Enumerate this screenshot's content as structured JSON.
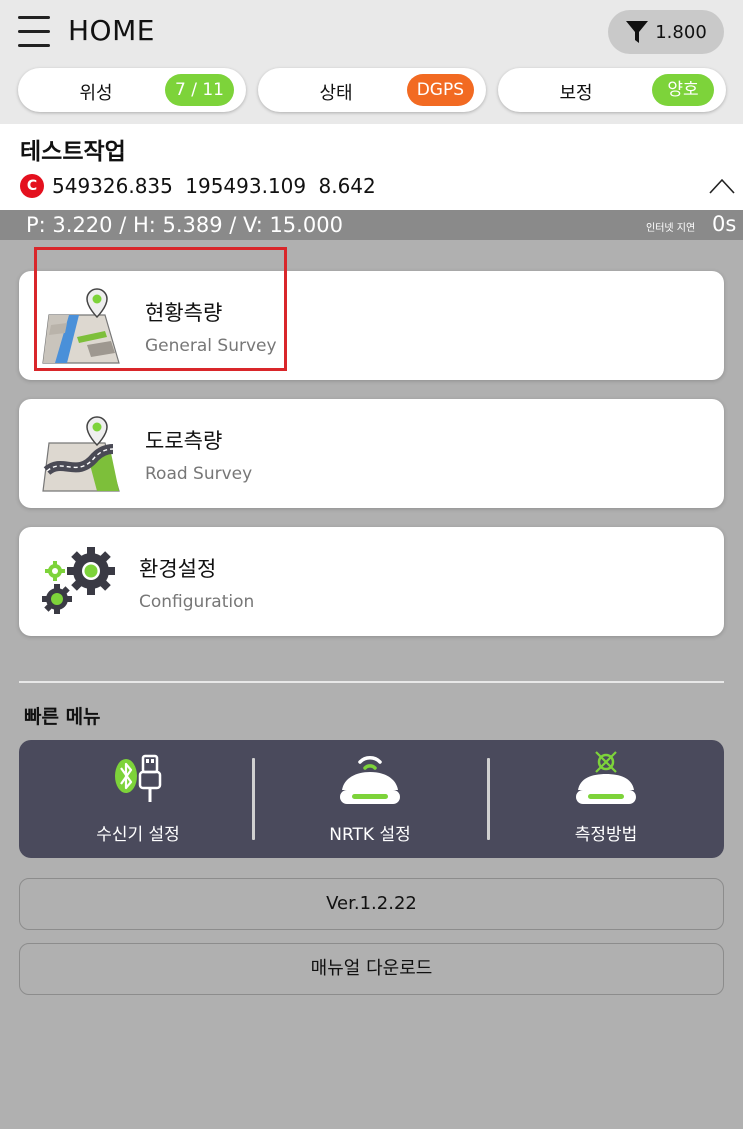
{
  "header": {
    "title": "HOME",
    "filter_value": "1.800"
  },
  "status": [
    {
      "label": "위성",
      "badge": "7 / 11",
      "badge_color": "#7dd33a"
    },
    {
      "label": "상태",
      "badge": "DGPS",
      "badge_color": "#f26a22"
    },
    {
      "label": "보정",
      "badge": "양호",
      "badge_color": "#7dd33a"
    }
  ],
  "project": {
    "name": "테스트작업",
    "coord_badge": "C",
    "x": "549326.835",
    "y": "195493.109",
    "z": "8.642"
  },
  "precision": {
    "text": "P: 3.220 / H: 5.389 / V: 15.000",
    "delay_label": "인터넷 지연",
    "delay_value": "0s"
  },
  "menu": [
    {
      "title": "현황측량",
      "subtitle": "General Survey",
      "icon": "map-pin-icon"
    },
    {
      "title": "도로측량",
      "subtitle": "Road Survey",
      "icon": "road-map-icon"
    },
    {
      "title": "환경설정",
      "subtitle": "Configuration",
      "icon": "gears-icon"
    }
  ],
  "quick_menu": {
    "title": "빠른 메뉴",
    "items": [
      {
        "label": "수신기 설정",
        "icon": "bluetooth-usb-icon"
      },
      {
        "label": "NRTK 설정",
        "icon": "wifi-receiver-icon"
      },
      {
        "label": "측정방법",
        "icon": "target-receiver-icon"
      }
    ]
  },
  "version_label": "Ver.1.2.22",
  "manual_label": "매뉴얼 다운로드",
  "colors": {
    "accent_green": "#7dd33a",
    "accent_orange": "#f26a22",
    "highlight_red": "#d9262a",
    "panel_dark": "#4a4a5c"
  }
}
